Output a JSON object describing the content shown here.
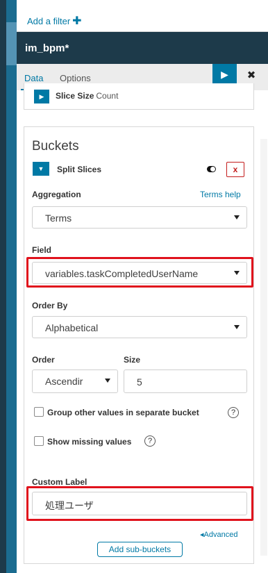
{
  "filter_bar": {
    "add_filter": "Add a filter",
    "plus": "✚"
  },
  "title_bar": {
    "title": "im_bpm*"
  },
  "tabs": {
    "data": "Data",
    "options": "Options"
  },
  "actions": {
    "run": "▶",
    "close": "✖"
  },
  "metric": {
    "label": "Slice Size",
    "sub": "Count"
  },
  "buckets": {
    "title": "Buckets",
    "split_label": "Split Slices",
    "remove": "x",
    "aggregation_label": "Aggregation",
    "terms_help": "Terms help",
    "aggregation_value": "Terms",
    "field_label": "Field",
    "field_value": "variables.taskCompletedUserName",
    "order_by_label": "Order By",
    "order_by_value": "Alphabetical",
    "order_label": "Order",
    "order_value": "Ascendir",
    "size_label": "Size",
    "size_value": "5",
    "group_other_label": "Group other values in separate bucket",
    "show_missing_label": "Show missing values",
    "help_mark": "?",
    "custom_label_label": "Custom Label",
    "custom_label_value": "処理ユーザ",
    "advanced": "◂Advanced",
    "add_sub_buckets": "Add sub-buckets"
  },
  "colors": {
    "accent": "#0079a5",
    "title_bg": "#1d3a4a",
    "highlight": "#e0121c"
  }
}
